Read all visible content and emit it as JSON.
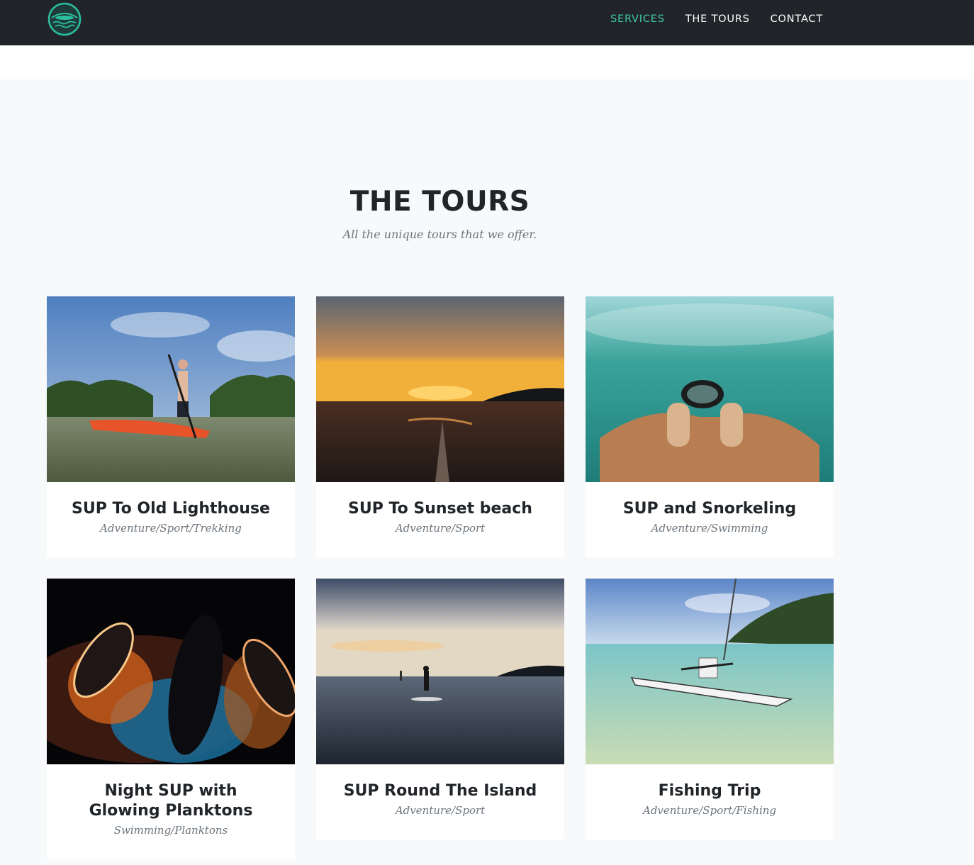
{
  "nav": {
    "items": [
      {
        "label": "SERVICES",
        "active": true
      },
      {
        "label": "THE TOURS",
        "active": false
      },
      {
        "label": "CONTACT",
        "active": false
      }
    ]
  },
  "section": {
    "heading": "THE TOURS",
    "subheading": "All the unique tours that we offer."
  },
  "tours": [
    {
      "title": "SUP To Old Lighthouse",
      "category": "Adventure/Sport/Trekking"
    },
    {
      "title": "SUP To Sunset beach",
      "category": "Adventure/Sport"
    },
    {
      "title": "SUP and Snorkeling",
      "category": "Adventure/Swimming"
    },
    {
      "title_line1": "Night SUP with",
      "title_line2": "Glowing Planktons",
      "category": "Swimming/Planktons"
    },
    {
      "title": "SUP Round The Island",
      "category": "Adventure/Sport"
    },
    {
      "title": "Fishing Trip",
      "category": "Adventure/Sport/Fishing"
    }
  ],
  "colors": {
    "accent": "#3fc9a6",
    "nav_bg": "#212529"
  }
}
